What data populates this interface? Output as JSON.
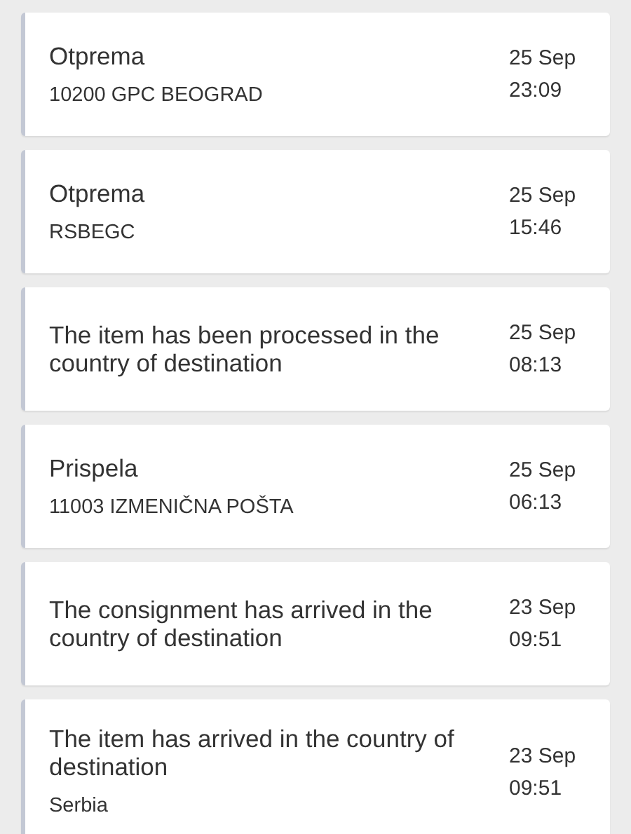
{
  "events": [
    {
      "title": "Otprema",
      "location": "10200 GPC BEOGRAD",
      "date": "25 Sep",
      "time": "23:09"
    },
    {
      "title": "Otprema",
      "location": "RSBEGC",
      "date": "25 Sep",
      "time": "15:46"
    },
    {
      "title": "The item has been processed in the country of destination",
      "date": "25 Sep",
      "time": "08:13"
    },
    {
      "title": "Prispela",
      "location": "11003 IZMENIČNA POŠTA",
      "date": "25 Sep",
      "time": "06:13"
    },
    {
      "title": "The consignment has arrived in the country of destination",
      "date": "23 Sep",
      "time": "09:51"
    },
    {
      "title": "The item has arrived in the country of destination",
      "location": "Serbia",
      "date": "23 Sep",
      "time": "09:51"
    }
  ]
}
